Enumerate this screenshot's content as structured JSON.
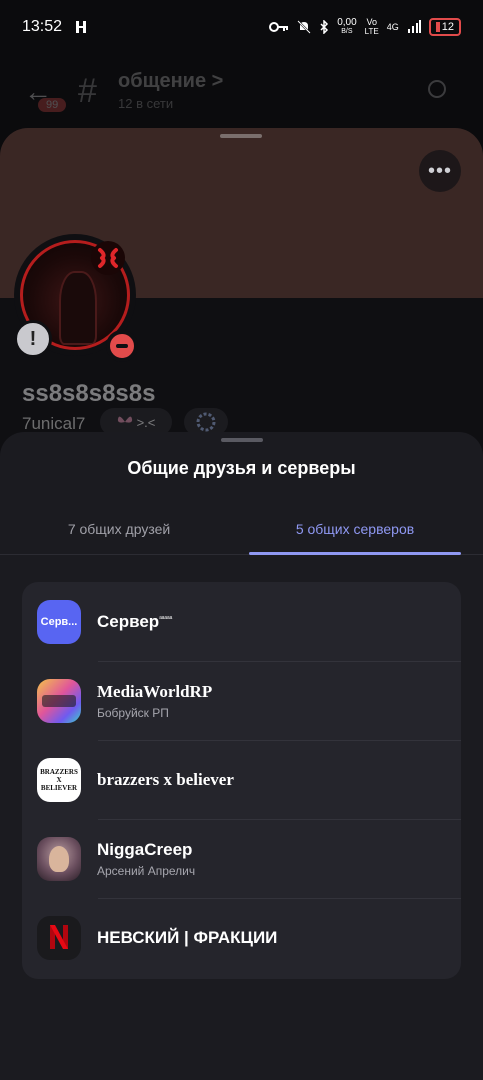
{
  "status_bar": {
    "time": "13:52",
    "net_speed_value": "0,00",
    "net_speed_unit": "B/S",
    "network_top": "Vo",
    "network_bottom": "LTE",
    "signal_label": "4G",
    "battery": "12"
  },
  "channel_header": {
    "title": "общение >",
    "subtitle": "12 в сети",
    "unread_badge": "99"
  },
  "profile": {
    "display_name": "ss8s8s8s8s",
    "username": "7unical7",
    "tag_text": ">.<",
    "more_button": "•••",
    "exclaim": "!"
  },
  "sheet": {
    "title": "Общие друзья и серверы",
    "tabs": [
      {
        "label": "7 общих друзей",
        "active": false
      },
      {
        "label": "5 общих серверов",
        "active": true
      }
    ],
    "servers": [
      {
        "name": "Сервер",
        "name_suffix": "ᵃᵃᵃᵃᵃ",
        "subtitle": "",
        "icon_text": "Серв..."
      },
      {
        "name": "MediaWorldRP",
        "subtitle": "Бобруйск РП",
        "icon_text": ""
      },
      {
        "name": "brazzers x believer",
        "subtitle": "",
        "icon_text_top": "BRAZZERS",
        "icon_text_mid": "X",
        "icon_text_bottom": "BELIEVER"
      },
      {
        "name": "NiggaCreep",
        "subtitle": "Арсений Апрелич",
        "icon_text": ""
      },
      {
        "name": "НЕВСКИЙ | ФРАКЦИИ",
        "subtitle": "",
        "icon_text": ""
      }
    ]
  },
  "colors": {
    "accent": "#8f98f2",
    "sheet_bg": "#1b1b20",
    "list_bg": "#25252c",
    "banner": "#3a2724",
    "dnd_red": "#e24b4b",
    "blurple": "#5865f2"
  }
}
